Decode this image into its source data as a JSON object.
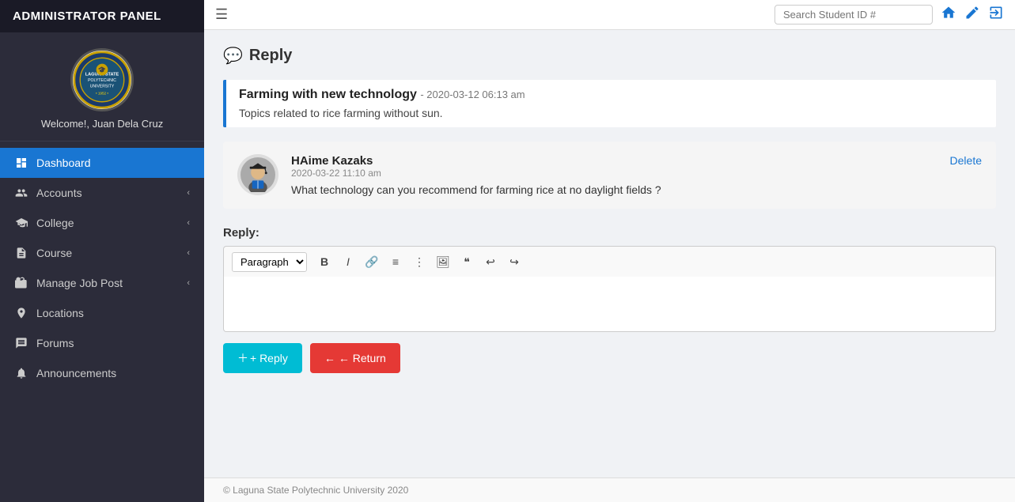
{
  "sidebar": {
    "title": "ADMINISTRATOR PANEL",
    "welcome": "Welcome!, Juan Dela Cruz",
    "nav": [
      {
        "id": "dashboard",
        "label": "Dashboard",
        "icon": "dashboard",
        "active": true,
        "hasChevron": false
      },
      {
        "id": "accounts",
        "label": "Accounts",
        "icon": "accounts",
        "active": false,
        "hasChevron": true
      },
      {
        "id": "college",
        "label": "College",
        "icon": "college",
        "active": false,
        "hasChevron": true
      },
      {
        "id": "course",
        "label": "Course",
        "icon": "course",
        "active": false,
        "hasChevron": true
      },
      {
        "id": "manage-job-post",
        "label": "Manage Job Post",
        "icon": "job",
        "active": false,
        "hasChevron": true
      },
      {
        "id": "locations",
        "label": "Locations",
        "icon": "locations",
        "active": false,
        "hasChevron": false
      },
      {
        "id": "forums",
        "label": "Forums",
        "icon": "forums",
        "active": false,
        "hasChevron": false
      },
      {
        "id": "announcements",
        "label": "Announcements",
        "icon": "announcements",
        "active": false,
        "hasChevron": false
      }
    ]
  },
  "topbar": {
    "search_placeholder": "Search Student ID #"
  },
  "page": {
    "title": "Reply",
    "post": {
      "title": "Farming with new technology",
      "date": "- 2020-03-12 06:13 am",
      "body": "Topics related to rice farming without sun."
    },
    "comment": {
      "author": "HAime Kazaks",
      "date": "2020-03-22 11:10 am",
      "text": "What technology can you recommend for farming rice at no daylight fields ?",
      "delete_label": "Delete"
    },
    "reply_label": "Reply:",
    "editor_format": "Paragraph",
    "buttons": {
      "reply": "+ Reply",
      "return": "← Return"
    }
  },
  "footer": {
    "text": "© Laguna State Polytechnic University 2020"
  }
}
